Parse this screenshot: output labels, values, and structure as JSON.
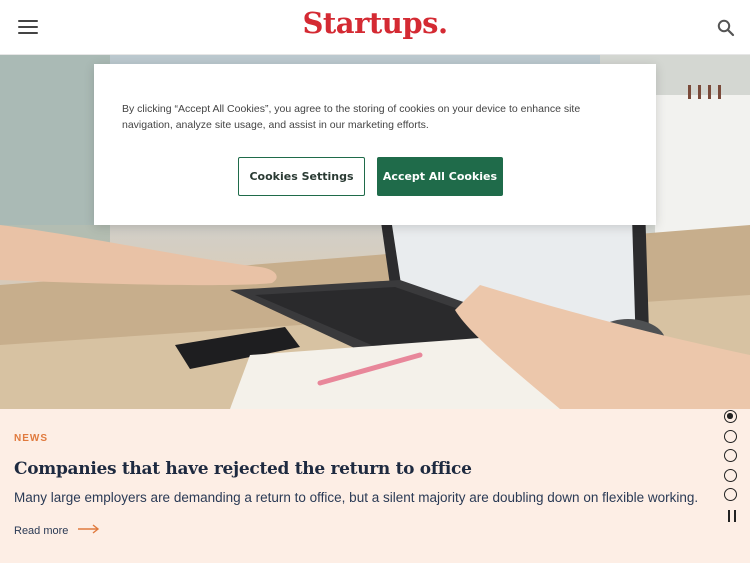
{
  "header": {
    "logo_text": "Startups.",
    "menu_icon": "hamburger-menu-icon",
    "search_icon": "search-icon"
  },
  "cookie_banner": {
    "message": "By clicking “Accept All Cookies”, you agree to the storing of cookies on your device to enhance site navigation, analyze site usage, and assist in our marketing efforts.",
    "settings_label": "Cookies Settings",
    "accept_label": "Accept All Cookies"
  },
  "article": {
    "category": "NEWS",
    "headline": "Companies that have rejected the return to office",
    "summary": "Many large employers are demanding a return to office, but a silent majority are doubling down on flexible working.",
    "read_more": "Read more"
  },
  "carousel": {
    "slide_count": 5,
    "active_index": 0
  },
  "colors": {
    "brand_red": "#d42a33",
    "accept_green": "#1f6b4a",
    "card_background": "#fdeee5",
    "category_orange": "#e07a3e",
    "headline_navy": "#1e2a40"
  }
}
